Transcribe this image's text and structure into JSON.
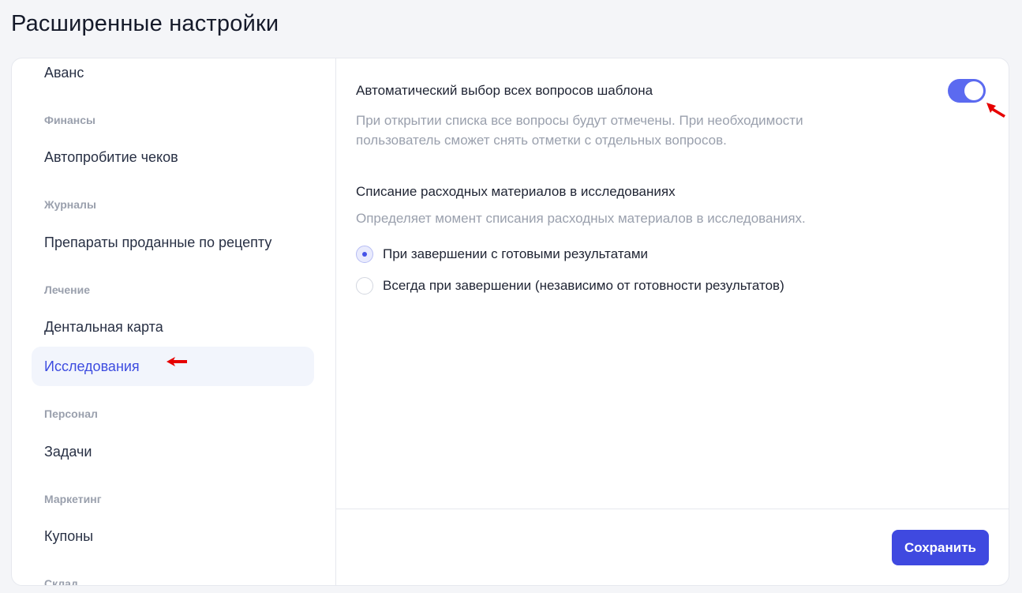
{
  "page": {
    "title": "Расширенные настройки"
  },
  "sidebar": {
    "items": [
      {
        "type": "item",
        "label": "Аванс"
      },
      {
        "type": "group",
        "label": "Финансы"
      },
      {
        "type": "item",
        "label": "Автопробитие чеков"
      },
      {
        "type": "group",
        "label": "Журналы"
      },
      {
        "type": "item",
        "label": "Препараты проданные по рецепту"
      },
      {
        "type": "group",
        "label": "Лечение"
      },
      {
        "type": "item",
        "label": "Дентальная карта"
      },
      {
        "type": "item",
        "label": "Исследования",
        "active": true
      },
      {
        "type": "group",
        "label": "Персонал"
      },
      {
        "type": "item",
        "label": "Задачи"
      },
      {
        "type": "group",
        "label": "Маркетинг"
      },
      {
        "type": "item",
        "label": "Купоны"
      },
      {
        "type": "group",
        "label": "Склад"
      }
    ]
  },
  "settings": {
    "auto_select": {
      "title": "Автоматический выбор всех вопросов шаблона",
      "desc_line1": "При открытии списка все вопросы будут отмечены. При необходимости",
      "desc_line2": "пользователь сможет снять отметки с отдельных вопросов.",
      "enabled": true
    },
    "write_off": {
      "title": "Списание расходных материалов в исследованиях",
      "desc": "Определяет момент списания расходных материалов в исследованиях.",
      "options": [
        {
          "label": "При завершении с готовыми результатами",
          "selected": true
        },
        {
          "label": "Всегда при завершении (независимо от готовности результатов)",
          "selected": false
        }
      ]
    }
  },
  "footer": {
    "save_label": "Сохранить"
  },
  "colors": {
    "accent": "#3f49e0",
    "toggle_on": "#5b6af0",
    "active_item_bg": "#f2f5fc",
    "annotation_arrow": "#e60000"
  }
}
